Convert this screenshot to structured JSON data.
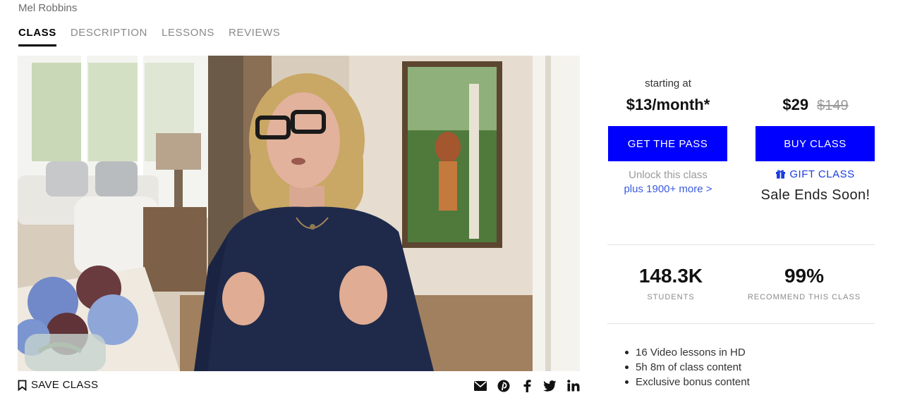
{
  "instructor": "Mel Robbins",
  "tabs": [
    {
      "label": "CLASS",
      "active": true
    },
    {
      "label": "DESCRIPTION",
      "active": false
    },
    {
      "label": "LESSONS",
      "active": false
    },
    {
      "label": "REVIEWS",
      "active": false
    }
  ],
  "pass": {
    "starting_at": "starting at",
    "price": "$13/month*",
    "button": "GET THE PASS",
    "unlock": "Unlock this class",
    "more_link": "plus 1900+ more >"
  },
  "buy": {
    "price": "$29",
    "old_price": "$149",
    "button": "BUY CLASS",
    "gift": "GIFT CLASS",
    "sale": "Sale Ends Soon!"
  },
  "stats": {
    "students_value": "148.3K",
    "students_label": "STUDENTS",
    "recommend_value": "99%",
    "recommend_label": "RECOMMEND THIS CLASS"
  },
  "features": [
    "16 Video lessons in HD",
    "5h 8m of class content",
    "Exclusive bonus content"
  ],
  "bottom": {
    "save": "SAVE CLASS",
    "share_icons": [
      "envelope-icon",
      "pinterest-icon",
      "facebook-icon",
      "twitter-icon",
      "linkedin-icon"
    ]
  },
  "colors": {
    "accent": "#0000ff",
    "link": "#3a5be0",
    "muted": "#8a8a8a"
  }
}
